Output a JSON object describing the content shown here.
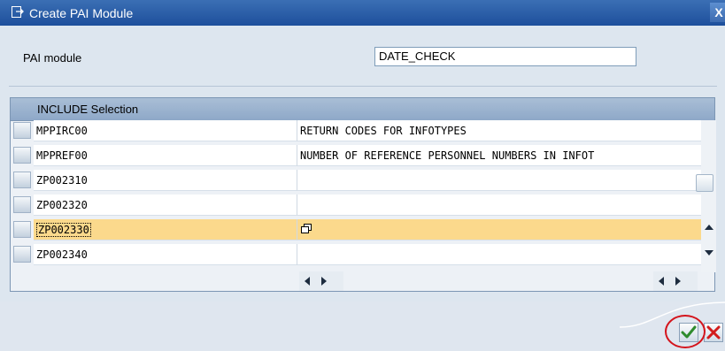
{
  "window": {
    "title": "Create PAI Module",
    "close_glyph": "X"
  },
  "form": {
    "pai_module_label": "PAI module",
    "pai_module_value": "DATE_CHECK"
  },
  "table": {
    "header": "INCLUDE Selection",
    "rows": [
      {
        "name": "MPPIRC00",
        "description": "RETURN CODES FOR INFOTYPES"
      },
      {
        "name": "MPPREF00",
        "description": "NUMBER OF REFERENCE PERSONNEL NUMBERS IN INFOT"
      },
      {
        "name": "ZP002310",
        "description": ""
      },
      {
        "name": "ZP002320",
        "description": ""
      },
      {
        "name": "ZP002330",
        "description": ""
      },
      {
        "name": "ZP002340",
        "description": ""
      }
    ],
    "selected_row": 4
  },
  "colors": {
    "title_bar": "#1d4f9c",
    "highlight_row": "#fbd98c",
    "annotation_circle": "#d4141c",
    "ok_check": "#2e8b2e",
    "cancel_x": "#d21c1c"
  },
  "icons": {
    "title": "create-doc-icon",
    "f4_help": "value-help-icon",
    "ok": "green-check-icon",
    "cancel": "red-x-icon"
  }
}
